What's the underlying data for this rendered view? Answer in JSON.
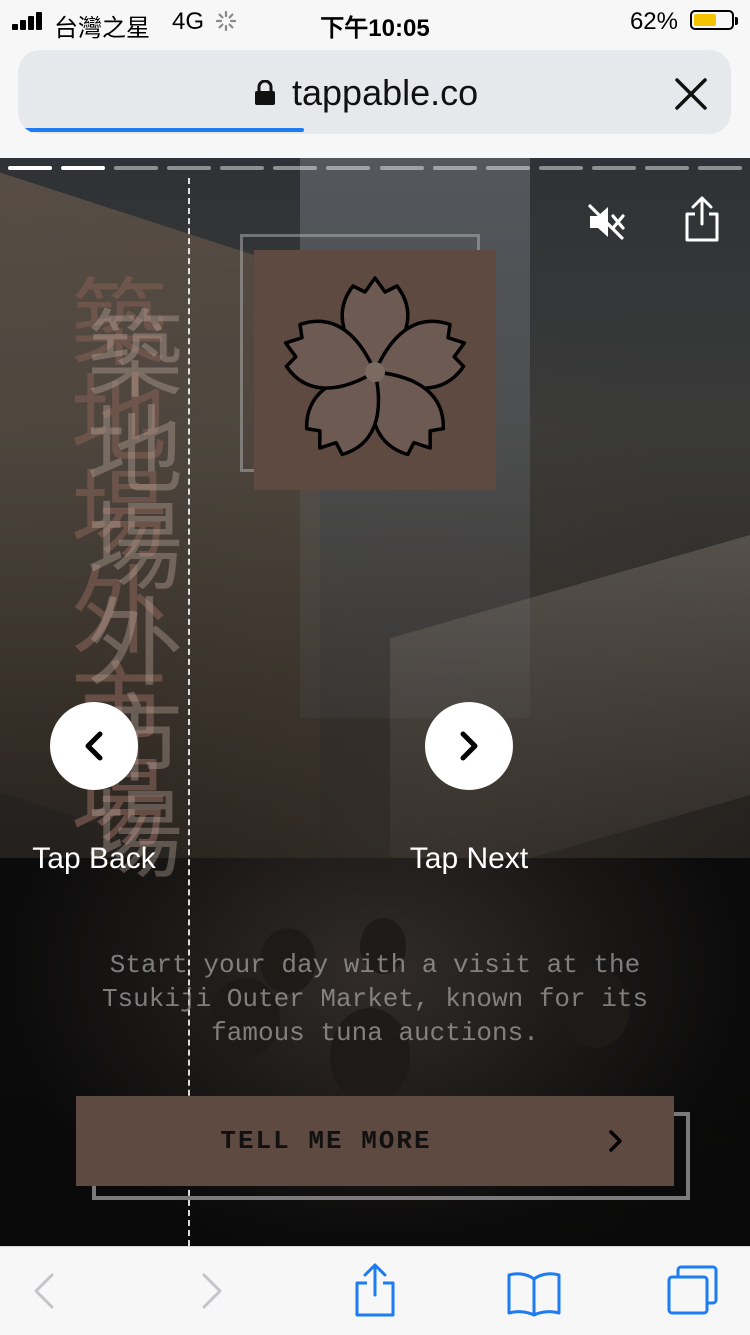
{
  "status_bar": {
    "carrier": "台灣之星",
    "network": "4G",
    "time": "下午10:05",
    "battery_percent": "62%",
    "battery_level": 0.62,
    "battery_color": "#f5c400"
  },
  "browser": {
    "url": "tappable.co",
    "load_progress": 0.4,
    "accent_color": "#1d7cf2",
    "icons": {
      "lock": "lock-icon",
      "close": "close-icon"
    }
  },
  "story": {
    "segments_total": 14,
    "segments_completed": 2,
    "vertical_title": "築地場外市場",
    "caption": "Start your day with a visit at the Tsukiji Outer Market, known for its famous tuna auctions.",
    "cta_label": "TELL ME MORE",
    "tap_back_label": "Tap Back",
    "tap_next_label": "Tap Next",
    "brand_color": "#5e4a40",
    "icons": {
      "mute": "mute-icon",
      "share": "share-icon",
      "logo": "cherry-blossom-icon",
      "back": "chevron-left-icon",
      "next": "chevron-right-icon",
      "cta": "chevron-right-icon"
    }
  },
  "toolbar": {
    "icons": [
      "back-arrow-icon",
      "forward-arrow-icon",
      "share-icon",
      "bookmarks-icon",
      "tabs-icon"
    ],
    "accent_color": "#1d7cf2"
  }
}
